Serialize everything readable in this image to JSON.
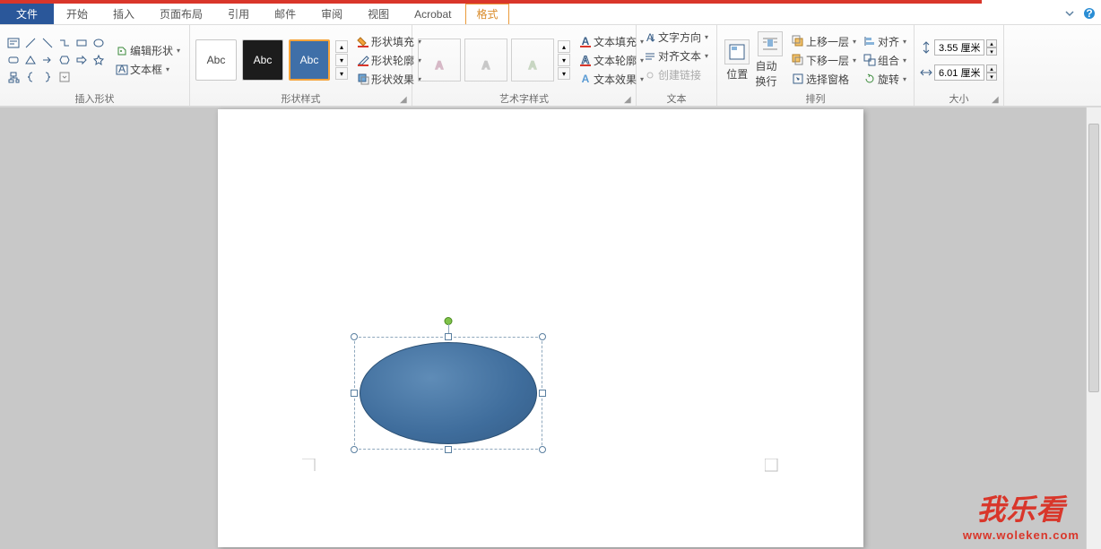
{
  "tabs": {
    "file": "文件",
    "home": "开始",
    "insert": "插入",
    "layout": "页面布局",
    "ref": "引用",
    "mail": "邮件",
    "review": "审阅",
    "view": "视图",
    "acrobat": "Acrobat",
    "format": "格式"
  },
  "groups": {
    "insertShapes": "插入形状",
    "shapeStyles": "形状样式",
    "wordArtStyles": "艺术字样式",
    "text": "文本",
    "arrange": "排列",
    "size": "大小"
  },
  "shapeSide": {
    "editShape": "编辑形状",
    "textBox": "文本框"
  },
  "styleGallery": {
    "abc": "Abc"
  },
  "shapeMenu": {
    "fill": "形状填充",
    "outline": "形状轮廓",
    "effects": "形状效果"
  },
  "waMenu": {
    "fill": "文本填充",
    "outline": "文本轮廓",
    "effects": "文本效果"
  },
  "textMenu": {
    "direction": "文字方向",
    "align": "对齐文本",
    "link": "创建链接"
  },
  "bigButtons": {
    "position": "位置",
    "wrap": "自动换行"
  },
  "arrange": {
    "forward": "上移一层",
    "backward": "下移一层",
    "selection": "选择窗格",
    "align": "对齐",
    "group": "组合",
    "rotate": "旋转"
  },
  "size": {
    "height": "3.55 厘米",
    "width": "6.01 厘米"
  },
  "watermark": {
    "main": "我乐看",
    "sub": "www.woleken.com"
  }
}
